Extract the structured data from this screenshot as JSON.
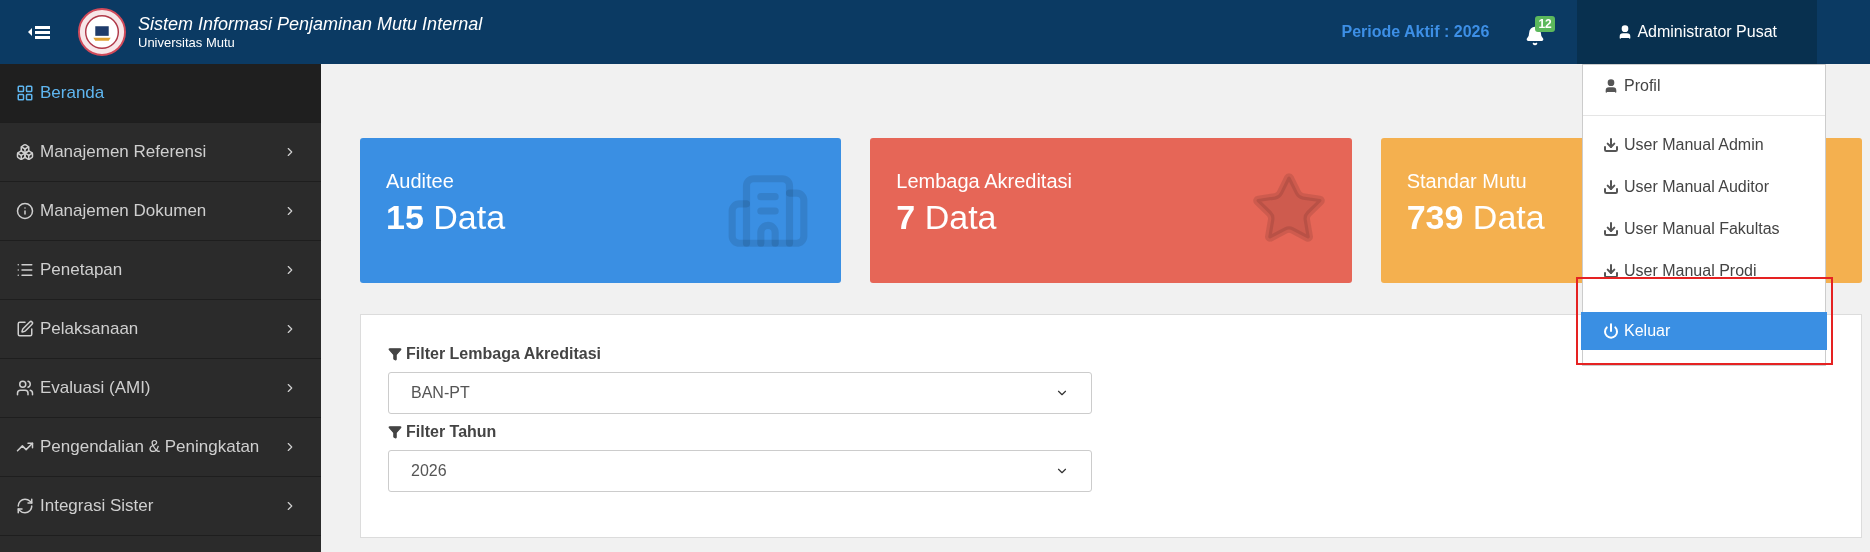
{
  "header": {
    "title": "Sistem Informasi Penjaminan Mutu Internal",
    "subtitle": "Universitas Mutu",
    "period": "Periode Aktif : 2026",
    "notification_count": "12",
    "user": "Administrator Pusat"
  },
  "sidebar": {
    "items": [
      {
        "label": "Beranda",
        "selected": true,
        "has_children": false
      },
      {
        "label": "Manajemen Referensi",
        "selected": false,
        "has_children": true
      },
      {
        "label": "Manajemen Dokumen",
        "selected": false,
        "has_children": true
      },
      {
        "label": "Penetapan",
        "selected": false,
        "has_children": true
      },
      {
        "label": "Pelaksanaan",
        "selected": false,
        "has_children": true
      },
      {
        "label": "Evaluasi (AMI)",
        "selected": false,
        "has_children": true
      },
      {
        "label": "Pengendalian & Peningkatan",
        "selected": false,
        "has_children": true
      },
      {
        "label": "Integrasi Sister",
        "selected": false,
        "has_children": true
      }
    ]
  },
  "cards": [
    {
      "title": "Auditee",
      "count": "15",
      "unit": "Data",
      "color": "#3a8fe3"
    },
    {
      "title": "Lembaga Akreditasi",
      "count": "7",
      "unit": "Data",
      "color": "#e66657"
    },
    {
      "title": "Standar Mutu",
      "count": "739",
      "unit": "Data",
      "color": "#f4b04f"
    }
  ],
  "filters": [
    {
      "label": "Filter Lembaga Akreditasi",
      "value": "BAN-PT"
    },
    {
      "label": "Filter Tahun",
      "value": "2026"
    }
  ],
  "user_menu": {
    "items": [
      {
        "label": "Profil",
        "kind": "profile",
        "selected": false,
        "annotated": false
      },
      {
        "label": "User Manual Admin",
        "kind": "download",
        "selected": false,
        "annotated": false
      },
      {
        "label": "User Manual Auditor",
        "kind": "download",
        "selected": false,
        "annotated": false
      },
      {
        "label": "User Manual Fakultas",
        "kind": "download",
        "selected": false,
        "annotated": false
      },
      {
        "label": "User Manual Prodi",
        "kind": "download",
        "selected": false,
        "annotated": false
      },
      {
        "label": "Keluar",
        "kind": "logout",
        "selected": true,
        "annotated": true
      }
    ]
  }
}
